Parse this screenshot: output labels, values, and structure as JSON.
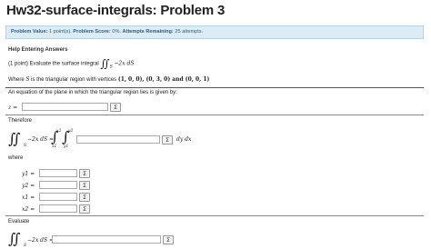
{
  "title": "Hw32-surface-integrals: Problem 3",
  "info": {
    "value_label": "Problem Value:",
    "value_text": "1 point(s).",
    "score_label": "Problem Score:",
    "score_text": "0%.",
    "attempts_label": "Attempts Remaining:",
    "attempts_text": "25 attempts."
  },
  "help": "Help Entering Answers",
  "problem": {
    "intro": "(1 point) Evaluate the surface integral",
    "integrand": "−2x dS",
    "domain": "S",
    "where_prefix": "Where",
    "where_var": "S",
    "where_text": "is the triangular region with vertices",
    "vertices": "(1, 0, 0), (0, 3, 0) and (0, 0, 1)",
    "plane_text": "An equation of the plane in which the triangular region lies is given by:",
    "z_label": "z =",
    "therefore": "Therefore",
    "lhs": "−2x dS =",
    "upper_outer": "x2",
    "lower_outer": "x1",
    "upper_inner": "y2",
    "lower_inner": "y1",
    "dydx": "dy dx",
    "where2": "where",
    "bounds": [
      {
        "label": "y1 ="
      },
      {
        "label": "y2 ="
      },
      {
        "label": "x1 ="
      },
      {
        "label": "x2 ="
      }
    ],
    "evaluate": "Evaluate",
    "eval_lhs": "−2x dS ="
  },
  "sigma_symbol": "Σ"
}
